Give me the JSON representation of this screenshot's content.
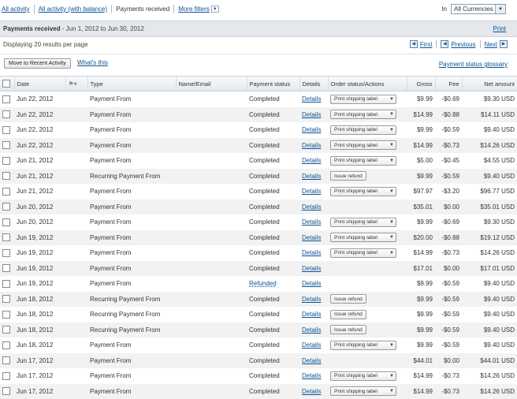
{
  "filters": {
    "all_activity": "All activity",
    "all_activity_balance": "All activity (with balance)",
    "payments_received": "Payments received",
    "more_filters": "More filters"
  },
  "currency": {
    "in_label": "In",
    "selected": "All Currencies"
  },
  "header": {
    "title": "Payments received",
    "range": " - Jun 1, 2012 to Jun 30, 2012",
    "print": "Print"
  },
  "pager": {
    "display": "Displaying 20 results per page",
    "first": "First",
    "previous": "Previous",
    "next": "Next"
  },
  "actions": {
    "move_button": "Move to Recent Activity",
    "whats_this": "What's this",
    "glossary": "Payment status glossary"
  },
  "columns": [
    "Date",
    "Type",
    "Name/Email",
    "Payment status",
    "Details",
    "Order status/Actions",
    "Gross",
    "Fee",
    "Net amount"
  ],
  "rows": [
    {
      "date": "Jun 22, 2012",
      "type": "Payment From",
      "status": "Completed",
      "details": "Details",
      "action": "Print shipping label",
      "gross": "$9.99",
      "fee": "-$0.69",
      "net": "$9.30 USD"
    },
    {
      "date": "Jun 22, 2012",
      "type": "Payment From",
      "status": "Completed",
      "details": "Details",
      "action": "Print shipping label",
      "gross": "$14.99",
      "fee": "-$0.88",
      "net": "$14.11 USD"
    },
    {
      "date": "Jun 22, 2012",
      "type": "Payment From",
      "status": "Completed",
      "details": "Details",
      "action": "Print shipping label",
      "gross": "$9.99",
      "fee": "-$0.59",
      "net": "$9.40 USD"
    },
    {
      "date": "Jun 22, 2012",
      "type": "Payment From",
      "status": "Completed",
      "details": "Details",
      "action": "Print shipping label",
      "gross": "$14.99",
      "fee": "-$0.73",
      "net": "$14.26 USD"
    },
    {
      "date": "Jun 21, 2012",
      "type": "Payment From",
      "status": "Completed",
      "details": "Details",
      "action": "Print shipping label",
      "gross": "$5.00",
      "fee": "-$0.45",
      "net": "$4.55 USD"
    },
    {
      "date": "Jun 21, 2012",
      "type": "Recurring Payment From",
      "status": "Completed",
      "details": "Details",
      "action": "Issue refund",
      "gross": "$9.99",
      "fee": "-$0.59",
      "net": "$9.40 USD"
    },
    {
      "date": "Jun 21, 2012",
      "type": "Payment From",
      "status": "Completed",
      "details": "Details",
      "action": "Print shipping label",
      "gross": "$97.97",
      "fee": "-$3.20",
      "net": "$96.77 USD"
    },
    {
      "date": "Jun 20, 2012",
      "type": "Payment From",
      "status": "Completed",
      "details": "Details",
      "action": "",
      "gross": "$35.01",
      "fee": "$0.00",
      "net": "$35.01 USD"
    },
    {
      "date": "Jun 20, 2012",
      "type": "Payment From",
      "status": "Completed",
      "details": "Details",
      "action": "Print shipping label",
      "gross": "$9.99",
      "fee": "-$0.69",
      "net": "$9.30 USD"
    },
    {
      "date": "Jun 19, 2012",
      "type": "Payment From",
      "status": "Completed",
      "details": "Details",
      "action": "Print shipping label",
      "gross": "$20.00",
      "fee": "-$0.88",
      "net": "$19.12 USD"
    },
    {
      "date": "Jun 19, 2012",
      "type": "Payment From",
      "status": "Completed",
      "details": "Details",
      "action": "Print shipping label",
      "gross": "$14.99",
      "fee": "-$0.73",
      "net": "$14.26 USD"
    },
    {
      "date": "Jun 19, 2012",
      "type": "Payment From",
      "status": "Completed",
      "details": "Details",
      "action": "",
      "gross": "$17.01",
      "fee": "$0.00",
      "net": "$17.01 USD"
    },
    {
      "date": "Jun 19, 2012",
      "type": "Payment From",
      "status": "Refunded",
      "details": "Details",
      "action": "",
      "gross": "$9.99",
      "fee": "-$0.59",
      "net": "$9.40 USD"
    },
    {
      "date": "Jun 18, 2012",
      "type": "Recurring Payment From",
      "status": "Completed",
      "details": "Details",
      "action": "Issue refund",
      "gross": "$9.99",
      "fee": "-$0.59",
      "net": "$9.40 USD"
    },
    {
      "date": "Jun 18, 2012",
      "type": "Recurring Payment From",
      "status": "Completed",
      "details": "Details",
      "action": "Issue refund",
      "gross": "$9.99",
      "fee": "-$0.59",
      "net": "$9.40 USD"
    },
    {
      "date": "Jun 18, 2012",
      "type": "Recurring Payment From",
      "status": "Completed",
      "details": "Details",
      "action": "Issue refund",
      "gross": "$9.99",
      "fee": "-$0.59",
      "net": "$9.40 USD"
    },
    {
      "date": "Jun 18, 2012",
      "type": "Payment From",
      "status": "Completed",
      "details": "Details",
      "action": "Print shipping label",
      "gross": "$9.99",
      "fee": "-$0.59",
      "net": "$9.40 USD"
    },
    {
      "date": "Jun 17, 2012",
      "type": "Payment From",
      "status": "Completed",
      "details": "Details",
      "action": "",
      "gross": "$44.01",
      "fee": "$0.00",
      "net": "$44.01 USD"
    },
    {
      "date": "Jun 17, 2012",
      "type": "Payment From",
      "status": "Completed",
      "details": "Details",
      "action": "Print shipping label",
      "gross": "$14.99",
      "fee": "-$0.73",
      "net": "$14.26 USD"
    },
    {
      "date": "Jun 17, 2012",
      "type": "Payment From",
      "status": "Completed",
      "details": "Details",
      "action": "Print shipping label",
      "gross": "$14.99",
      "fee": "-$0.73",
      "net": "$14.26 USD"
    }
  ]
}
